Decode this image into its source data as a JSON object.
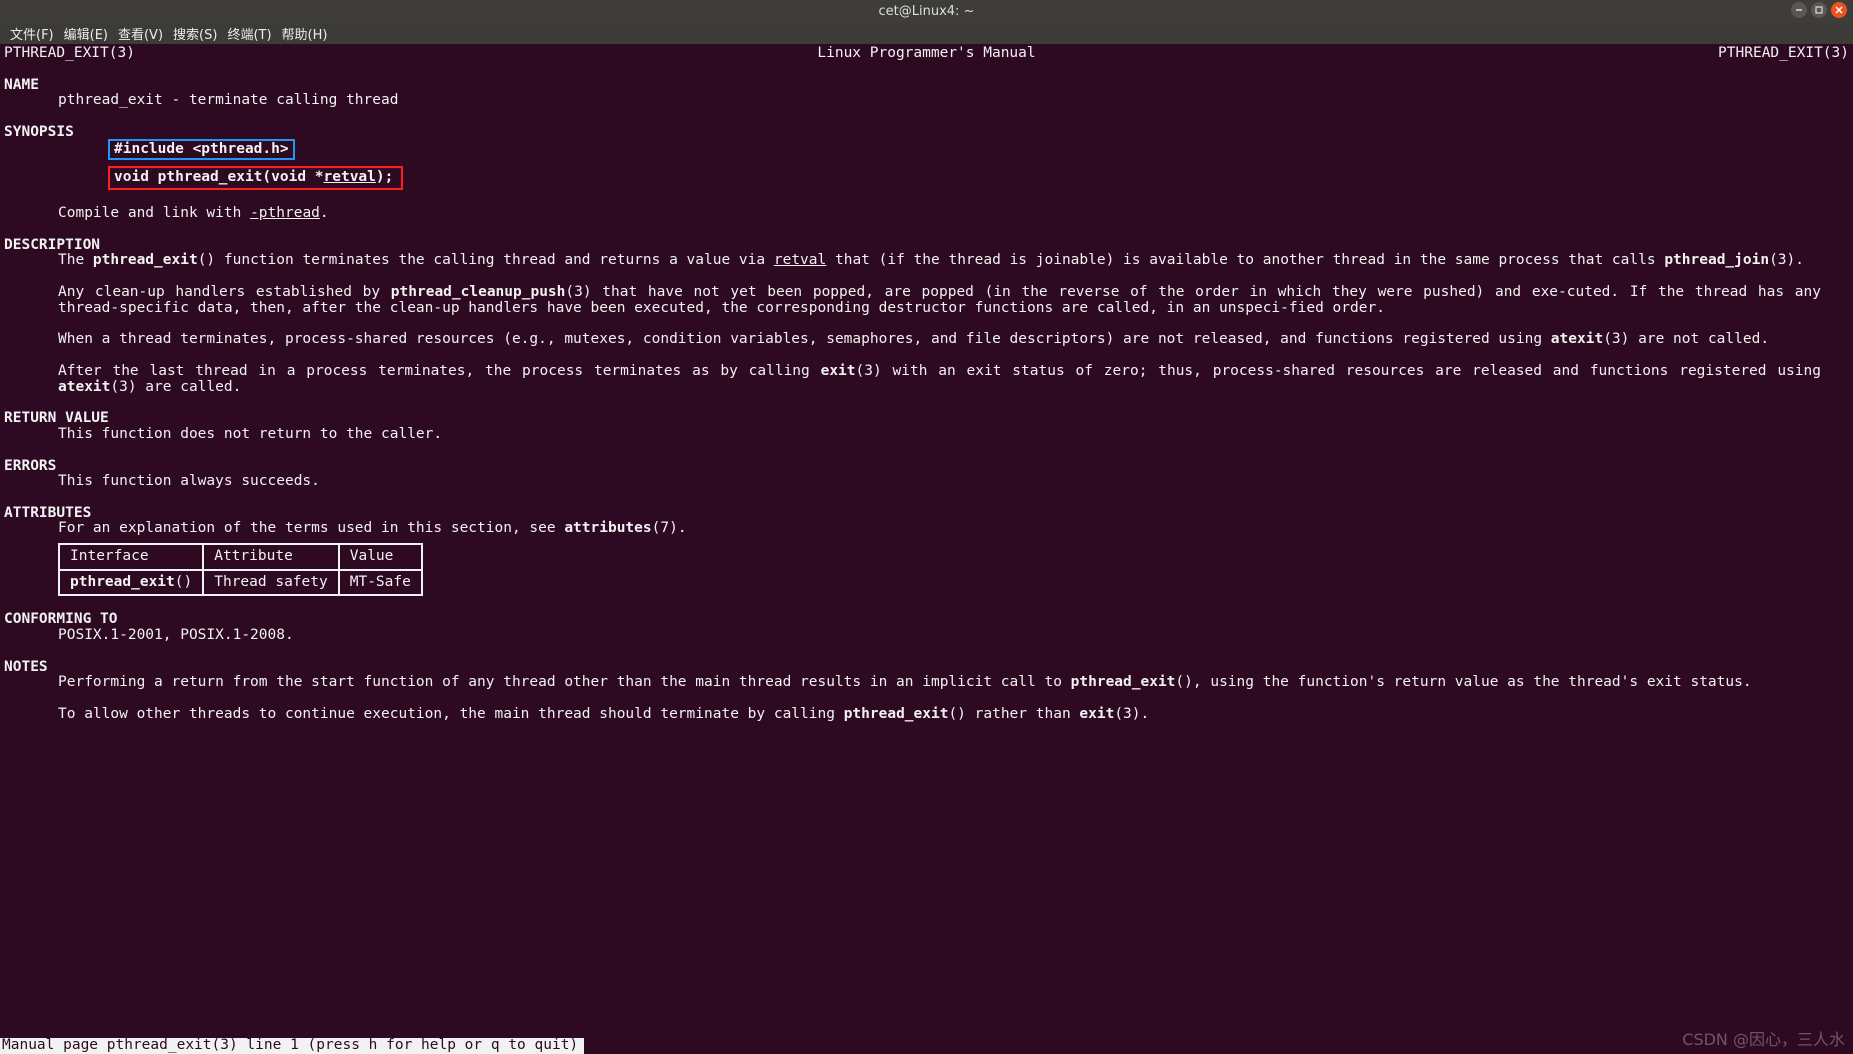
{
  "window": {
    "title": "cet@Linux4: ~"
  },
  "menubar": [
    "文件(F)",
    "编辑(E)",
    "查看(V)",
    "搜索(S)",
    "终端(T)",
    "帮助(H)"
  ],
  "header": {
    "left": "PTHREAD_EXIT(3)",
    "center": "Linux Programmer's Manual",
    "right": "PTHREAD_EXIT(3)"
  },
  "sections": {
    "name_h": "NAME",
    "name_l": "pthread_exit - terminate calling thread",
    "syn_h": "SYNOPSIS",
    "syn_inc": "#include <pthread.h>",
    "syn_sig_pre": "void pthread_exit(void *",
    "syn_sig_arg": "retval",
    "syn_sig_post": ");",
    "syn_comp_pre": "Compile and link with ",
    "syn_comp_flag": "-pthread",
    "syn_comp_post": ".",
    "desc_h": "DESCRIPTION",
    "desc_p1_a": "The  ",
    "desc_p1_b": "pthread_exit",
    "desc_p1_c": "()  function  terminates  the  calling  thread  and returns a value via ",
    "desc_p1_d": "retval",
    "desc_p1_e": " that (if the thread is joinable) is available to another thread in the same process that calls ",
    "desc_p1_f": "pthread_join",
    "desc_p1_g": "(3).",
    "desc_p2_a": "Any clean-up handlers established by ",
    "desc_p2_b": "pthread_cleanup_push",
    "desc_p2_c": "(3) that have not yet been popped, are popped (in the reverse of the order in which they  were  pushed)  and  exe‐cuted.  If the thread has any thread-specific data, then, after the clean-up handlers have been executed, the corresponding destructor functions are called, in an unspeci‐fied order.",
    "desc_p3_a": "When a thread terminates, process-shared resources (e.g., mutexes, condition variables, semaphores, and file descriptors) are not released, and functions registered  using ",
    "desc_p3_b": "atexit",
    "desc_p3_c": "(3) are not called.",
    "desc_p4_a": "After  the  last  thread in a process terminates, the process terminates as by calling ",
    "desc_p4_b": "exit",
    "desc_p4_c": "(3) with an exit status of zero; thus, process-shared resources are released and functions registered using ",
    "desc_p4_d": "atexit",
    "desc_p4_e": "(3) are called.",
    "ret_h": "RETURN VALUE",
    "ret_l": "This function does not return to the caller.",
    "err_h": "ERRORS",
    "err_l": "This function always succeeds.",
    "attr_h": "ATTRIBUTES",
    "attr_l_a": "For an explanation of the terms used in this section, see ",
    "attr_l_b": "attributes",
    "attr_l_c": "(7).",
    "conf_h": "CONFORMING TO",
    "conf_l": "POSIX.1-2001, POSIX.1-2008.",
    "notes_h": "NOTES",
    "notes_p1_a": "Performing a return from the start function of any thread other than the main thread results in an implicit call to ",
    "notes_p1_b": "pthread_exit",
    "notes_p1_c": "(), using the function's  return  value  as the thread's exit status.",
    "notes_p2_a": "To allow other threads to continue execution, the main thread should terminate by calling ",
    "notes_p2_b": "pthread_exit",
    "notes_p2_c": "() rather than ",
    "notes_p2_d": "exit",
    "notes_p2_e": "(3)."
  },
  "table": {
    "h1": "Interface",
    "h2": "Attribute",
    "h3": "Value",
    "r1c1a": "pthread_exit",
    "r1c1b": "()",
    "r1c2": "Thread safety",
    "r1c3": "MT-Safe"
  },
  "status": " Manual page pthread_exit(3) line 1 (press h for help or q to quit)",
  "watermark": "CSDN @因心，三人水"
}
